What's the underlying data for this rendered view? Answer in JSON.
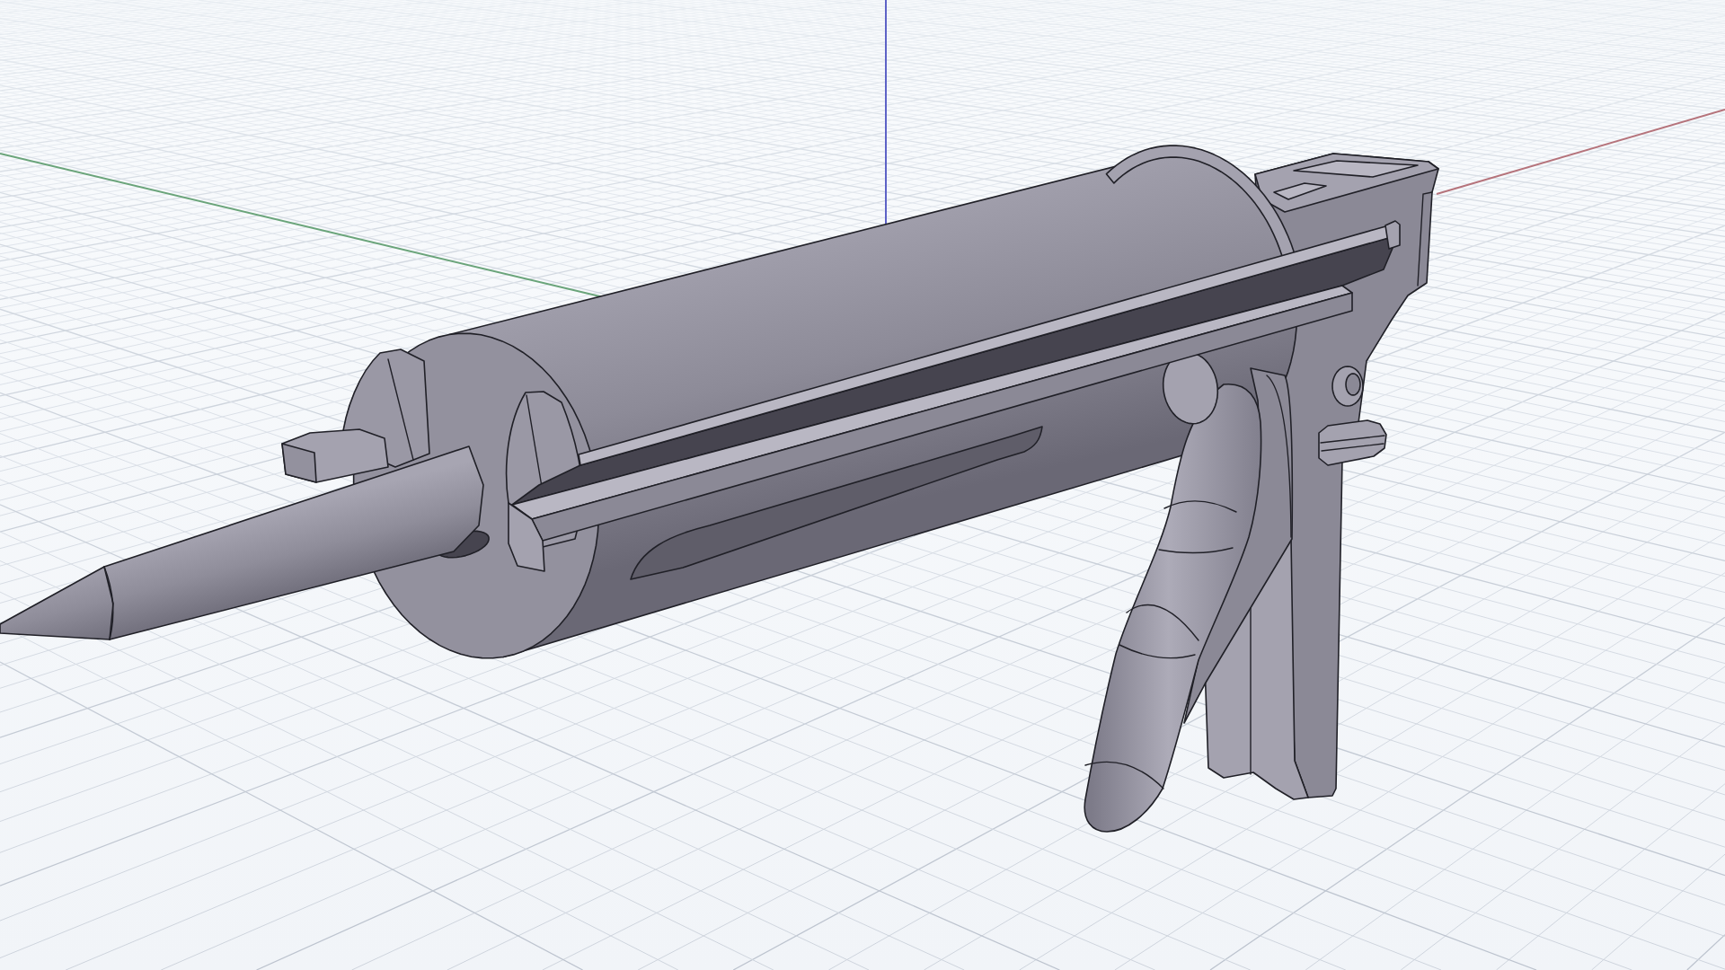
{
  "viewport": {
    "grid": {
      "visible": true
    },
    "axes": [
      {
        "kind": "x",
        "color": "#b5737b"
      },
      {
        "kind": "y",
        "color": "#6aa47a"
      },
      {
        "kind": "z",
        "color": "#5d62c6"
      }
    ],
    "model": {
      "kind": "caulking-gun"
    }
  }
}
